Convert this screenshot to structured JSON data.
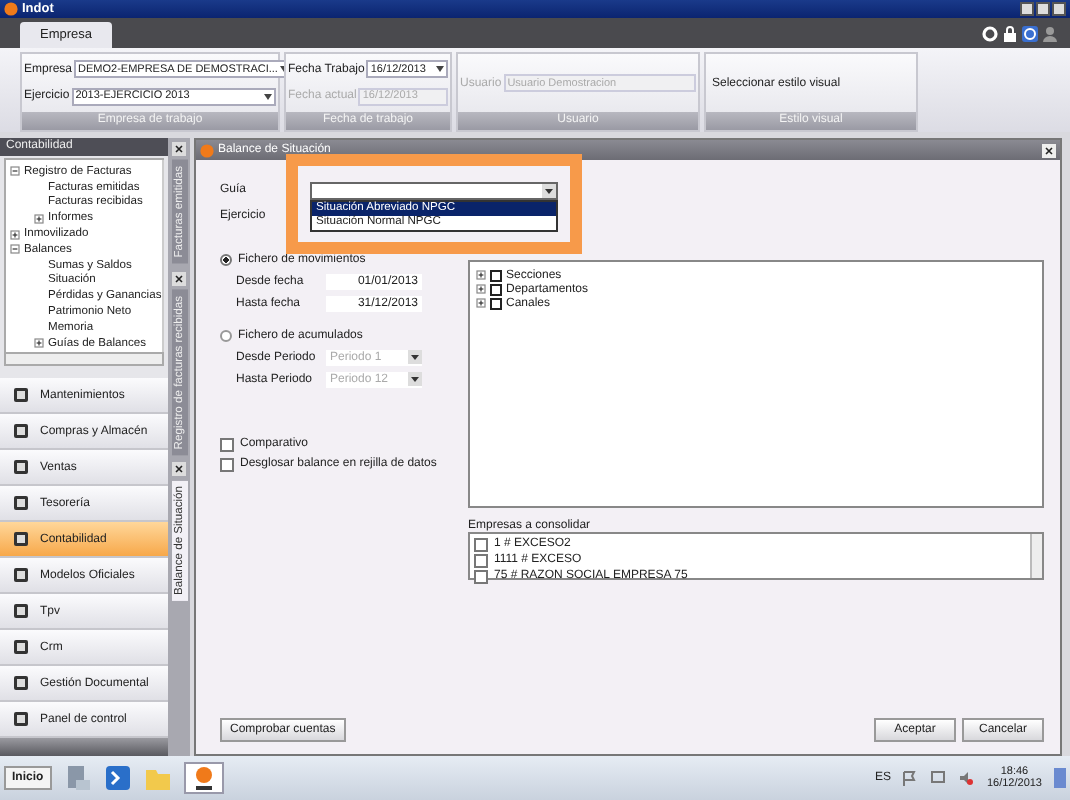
{
  "window": {
    "title": "Indot"
  },
  "ribbon_tabs": [
    {
      "label": "Empresa",
      "selected": true
    }
  ],
  "ribbon": {
    "groups": [
      {
        "kind": "fields",
        "caption": "Empresa de trabajo",
        "fields": [
          {
            "label": "Empresa",
            "value": "DEMO2-EMPRESA DE DEMOSTRACI...",
            "disabled": false,
            "dropdown": true
          },
          {
            "label": "Ejercicio",
            "value": "2013-EJERCICIO 2013",
            "disabled": false,
            "dropdown": true
          }
        ]
      },
      {
        "kind": "fields",
        "caption": "Fecha de trabajo",
        "fields": [
          {
            "label": "Fecha Trabajo",
            "value": "16/12/2013",
            "disabled": false,
            "dropdown": true
          },
          {
            "label": "Fecha actual",
            "value": "16/12/2013",
            "disabled": true,
            "dropdown": false
          }
        ]
      },
      {
        "kind": "fields",
        "caption": "Usuario",
        "fields": [
          {
            "label": "Usuario",
            "value": "Usuario Demostracion",
            "disabled": true,
            "dropdown": false
          }
        ]
      },
      {
        "kind": "selector",
        "caption": "Estilo visual",
        "value": "Seleccionar estilo visual"
      }
    ]
  },
  "sidebar": {
    "title": "Contabilidad",
    "tree": [
      {
        "label": "Registro de Facturas",
        "expanded": true,
        "children": [
          {
            "label": "Facturas emitidas"
          },
          {
            "label": "Facturas recibidas"
          },
          {
            "label": "Informes",
            "expanded": false
          }
        ]
      },
      {
        "label": "Inmovilizado",
        "expanded": false
      },
      {
        "label": "Balances",
        "expanded": true,
        "children": [
          {
            "label": "Sumas y Saldos"
          },
          {
            "label": "Situación"
          },
          {
            "label": "Pérdidas y Ganancias"
          },
          {
            "label": "Patrimonio Neto"
          },
          {
            "label": "Memoria"
          },
          {
            "label": "Guías de Balances",
            "expanded": false
          }
        ]
      }
    ],
    "modules": [
      {
        "label": "Mantenimientos",
        "selected": false
      },
      {
        "label": "Compras y Almacén",
        "selected": false
      },
      {
        "label": "Ventas",
        "selected": false
      },
      {
        "label": "Tesorería",
        "selected": false
      },
      {
        "label": "Contabilidad",
        "selected": true
      },
      {
        "label": "Modelos Oficiales",
        "selected": false
      },
      {
        "label": "Tpv",
        "selected": false
      },
      {
        "label": "Crm",
        "selected": false
      },
      {
        "label": "Gestión Documental",
        "selected": false
      },
      {
        "label": "Panel de control",
        "selected": false
      }
    ]
  },
  "document_tabs": [
    {
      "label": "Facturas emitidas",
      "selected": false
    },
    {
      "label": "Registro de facturas recibidas",
      "selected": false
    },
    {
      "label": "Balance de Situación",
      "selected": true
    }
  ],
  "dialog": {
    "title": "Balance de Situación",
    "guia": {
      "label": "Guía",
      "options": [
        {
          "label": "Situación Abreviado NPGC",
          "selected": true
        },
        {
          "label": "Situación Normal NPGC",
          "selected": false
        }
      ]
    },
    "ejercicio_label": "Ejercicio",
    "sources": [
      {
        "label": "Fichero de movimientos",
        "selected": true,
        "fields": [
          {
            "label": "Desde fecha",
            "value": "01/01/2013",
            "disabled": false
          },
          {
            "label": "Hasta fecha",
            "value": "31/12/2013",
            "disabled": false
          }
        ]
      },
      {
        "label": "Fichero de acumulados",
        "selected": false,
        "fields": [
          {
            "label": "Desde Periodo",
            "value": "Periodo 1",
            "disabled": true
          },
          {
            "label": "Hasta Periodo",
            "value": "Periodo 12",
            "disabled": true
          }
        ]
      }
    ],
    "options": [
      {
        "label": "Comparativo",
        "checked": false
      },
      {
        "label": "Desglosar balance en rejilla de datos",
        "checked": false
      }
    ],
    "selection_tree": [
      {
        "label": "Secciones",
        "checked": false,
        "expanded": false
      },
      {
        "label": "Departamentos",
        "checked": false,
        "expanded": false
      },
      {
        "label": "Canales",
        "checked": false,
        "expanded": false
      }
    ],
    "consolidate": {
      "label": "Empresas a consolidar",
      "items": [
        {
          "label": "1 # EXCESO2",
          "checked": false
        },
        {
          "label": "1111 # EXCESO",
          "checked": false
        },
        {
          "label": "75 # RAZON SOCIAL EMPRESA 75",
          "checked": false
        }
      ]
    },
    "buttons": {
      "left": "Comprobar cuentas",
      "accept": "Aceptar",
      "cancel": "Cancelar"
    }
  },
  "taskbar": {
    "start": "Inicio",
    "language": "ES",
    "time": "18:46",
    "date": "16/12/2013"
  }
}
